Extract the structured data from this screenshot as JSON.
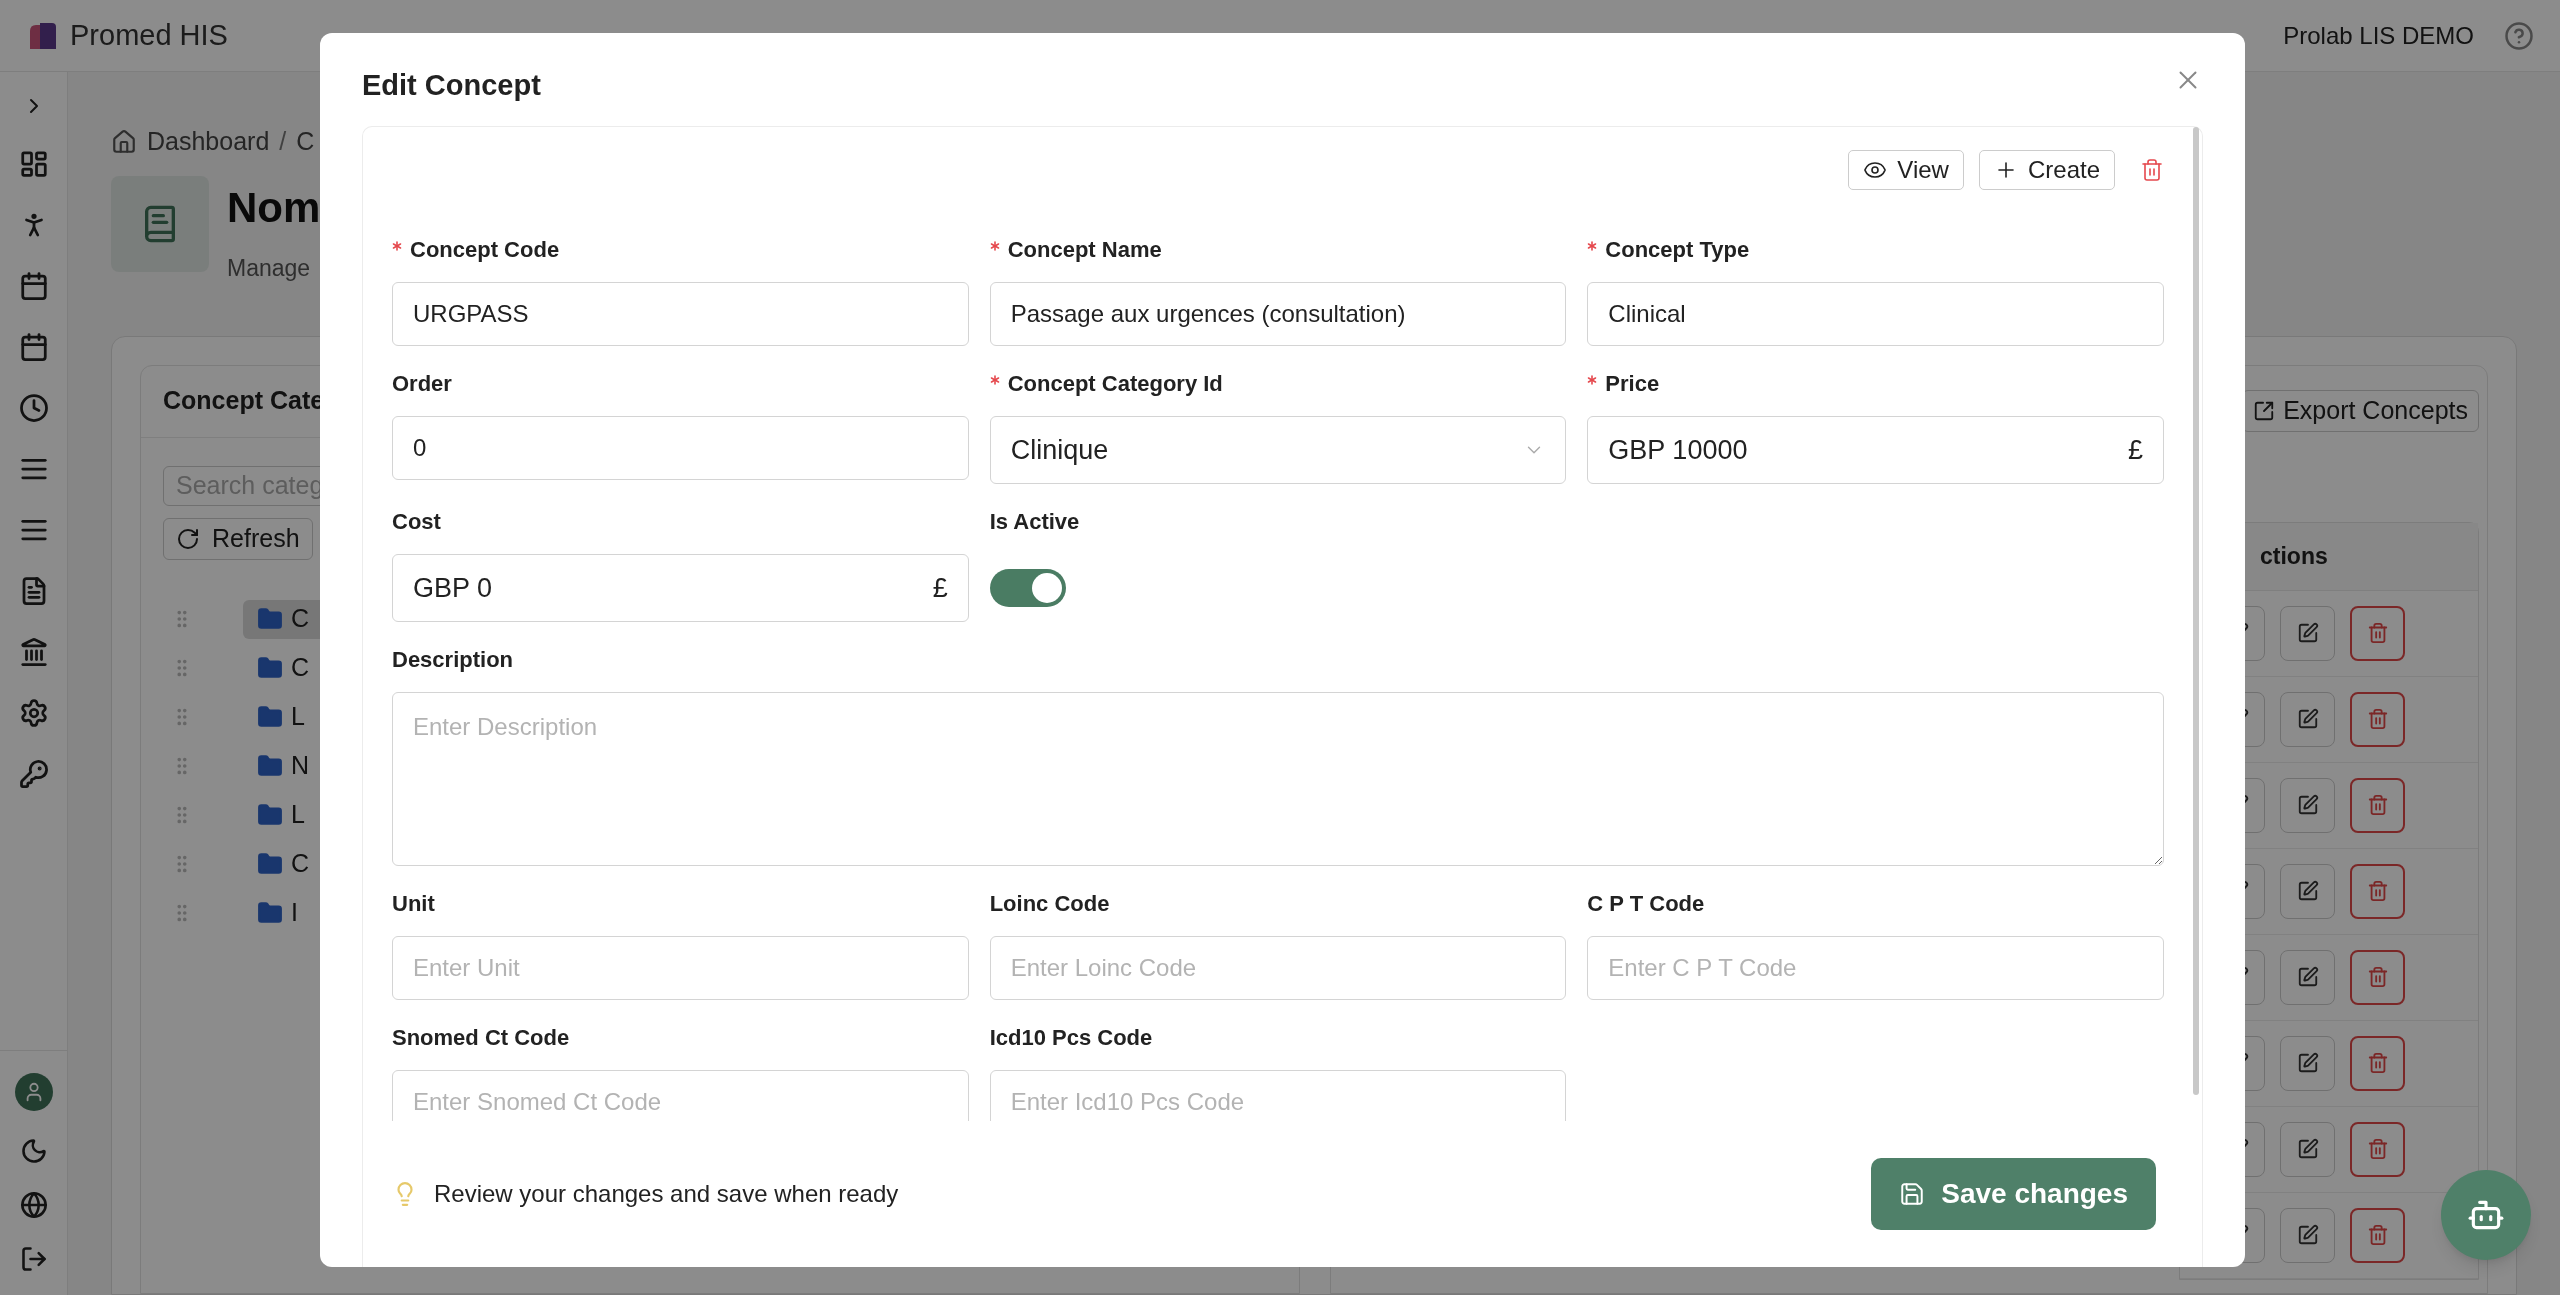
{
  "topbar": {
    "brand": "Promed HIS",
    "account": "Prolab LIS DEMO"
  },
  "page": {
    "breadcrumb": [
      {
        "label": "Dashboard"
      },
      {
        "label": "C"
      }
    ],
    "separator": "/",
    "title": "Nom",
    "subtitle": "Manage",
    "categories": {
      "title": "Concept Cate",
      "search_placeholder": "Search categ",
      "refresh": "Refresh",
      "items": [
        {
          "label": "C",
          "selected": true
        },
        {
          "label": "C",
          "selected": false
        },
        {
          "label": "L",
          "selected": false
        },
        {
          "label": "N",
          "selected": false
        },
        {
          "label": "L",
          "selected": false
        },
        {
          "label": "C",
          "selected": false
        },
        {
          "label": "I",
          "selected": false
        }
      ]
    },
    "concepts": {
      "export": "Export Concepts",
      "actions_header": "ctions"
    }
  },
  "modal": {
    "title": "Edit Concept",
    "actions": [
      "View",
      "Create"
    ],
    "fields": [
      {
        "kind": "text",
        "label": "Concept Code",
        "required": true,
        "value": "URGPASS"
      },
      {
        "kind": "text",
        "label": "Concept Name",
        "required": true,
        "value": "Passage aux urgences (consultation)"
      },
      {
        "kind": "text",
        "label": "Concept Type",
        "required": true,
        "value": "Clinical"
      },
      {
        "kind": "text",
        "label": "Order",
        "required": false,
        "value": "0"
      },
      {
        "kind": "select",
        "label": "Concept Category Id",
        "required": true,
        "value": "Clinique"
      },
      {
        "kind": "currency",
        "label": "Price",
        "required": true,
        "value": "GBP 10000",
        "suffix": "£"
      },
      {
        "kind": "currency",
        "label": "Cost",
        "required": false,
        "value": "GBP 0",
        "suffix": "£"
      },
      {
        "kind": "toggle",
        "label": "Is Active",
        "required": false,
        "on": true
      },
      {
        "kind": "textarea",
        "label": "Description",
        "required": false,
        "placeholder": "Enter Description"
      },
      {
        "kind": "text",
        "label": "Unit",
        "required": false,
        "placeholder": "Enter Unit"
      },
      {
        "kind": "text",
        "label": "Loinc Code",
        "required": false,
        "placeholder": "Enter Loinc Code"
      },
      {
        "kind": "text",
        "label": "C P T Code",
        "required": false,
        "placeholder": "Enter C P T Code"
      },
      {
        "kind": "text",
        "label": "Snomed Ct Code",
        "required": false,
        "placeholder": "Enter Snomed Ct Code"
      },
      {
        "kind": "text",
        "label": "Icd10 Pcs Code",
        "required": false,
        "placeholder": "Enter Icd10 Pcs Code"
      }
    ],
    "hint": "Review your changes and save when ready",
    "save": "Save changes"
  }
}
